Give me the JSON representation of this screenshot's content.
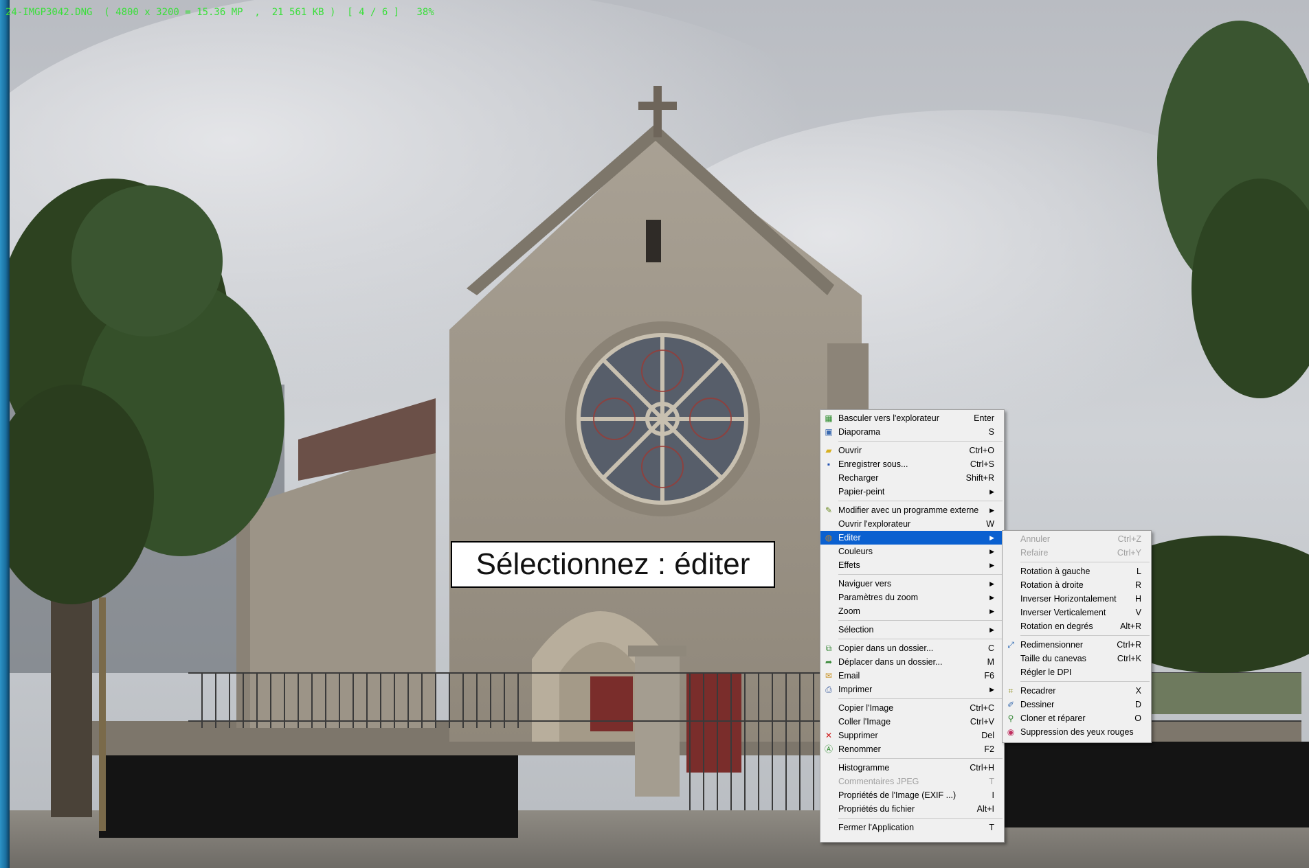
{
  "viewer": {
    "info": "24-IMGP3042.DNG  ( 4800 x 3200 = 15.36 MP  ,  21 561 KB )  [ 4 / 6 ]   38%"
  },
  "caption": "Sélectionnez : éditer",
  "context_menu": [
    {
      "label": "Basculer vers l'explorateur",
      "shortcut": "Enter",
      "icon": "explorer-icon"
    },
    {
      "label": "Diaporama",
      "shortcut": "S",
      "icon": "slideshow-icon"
    },
    {
      "sep": true
    },
    {
      "label": "Ouvrir",
      "shortcut": "Ctrl+O",
      "icon": "open-folder-icon"
    },
    {
      "label": "Enregistrer sous...",
      "shortcut": "Ctrl+S",
      "icon": "save-icon"
    },
    {
      "label": "Recharger",
      "shortcut": "Shift+R"
    },
    {
      "label": "Papier-peint",
      "submenu": true
    },
    {
      "sep": true
    },
    {
      "label": "Modifier avec un programme externe",
      "submenu": true,
      "icon": "external-program-icon"
    },
    {
      "label": "Ouvrir l'explorateur",
      "shortcut": "W"
    },
    {
      "label": "Editer",
      "submenu": true,
      "selected": true,
      "icon": "edit-palette-icon"
    },
    {
      "label": "Couleurs",
      "submenu": true
    },
    {
      "label": "Effets",
      "submenu": true
    },
    {
      "sep": true
    },
    {
      "label": "Naviguer vers",
      "submenu": true
    },
    {
      "label": "Paramètres du zoom",
      "submenu": true
    },
    {
      "label": "Zoom",
      "submenu": true
    },
    {
      "sep": true
    },
    {
      "label": "Sélection",
      "submenu": true
    },
    {
      "sep": true
    },
    {
      "label": "Copier dans un dossier...",
      "shortcut": "C",
      "icon": "copy-to-folder-icon"
    },
    {
      "label": "Déplacer dans un dossier...",
      "shortcut": "M",
      "icon": "move-to-folder-icon"
    },
    {
      "label": "Email",
      "shortcut": "F6",
      "icon": "email-icon"
    },
    {
      "label": "Imprimer",
      "submenu": true,
      "icon": "printer-icon"
    },
    {
      "sep": true
    },
    {
      "label": "Copier l'Image",
      "shortcut": "Ctrl+C"
    },
    {
      "label": "Coller l'Image",
      "shortcut": "Ctrl+V"
    },
    {
      "label": "Supprimer",
      "shortcut": "Del",
      "icon": "delete-x-icon"
    },
    {
      "label": "Renommer",
      "shortcut": "F2",
      "icon": "rename-icon"
    },
    {
      "sep": true
    },
    {
      "label": "Histogramme",
      "shortcut": "Ctrl+H"
    },
    {
      "label": "Commentaires JPEG",
      "shortcut": "T",
      "disabled": true
    },
    {
      "label": "Propriétés de l'Image (EXIF ...)",
      "shortcut": "I"
    },
    {
      "label": "Propriétés du fichier",
      "shortcut": "Alt+I"
    },
    {
      "sep": true
    },
    {
      "label": "Fermer l'Application",
      "shortcut": "T"
    }
  ],
  "edit_submenu": [
    {
      "label": "Annuler",
      "shortcut": "Ctrl+Z",
      "disabled": true
    },
    {
      "label": "Refaire",
      "shortcut": "Ctrl+Y",
      "disabled": true
    },
    {
      "sep": true
    },
    {
      "label": "Rotation à gauche",
      "shortcut": "L"
    },
    {
      "label": "Rotation à droite",
      "shortcut": "R"
    },
    {
      "label": "Inverser Horizontalement",
      "shortcut": "H"
    },
    {
      "label": "Inverser Verticalement",
      "shortcut": "V"
    },
    {
      "label": "Rotation en degrés",
      "shortcut": "Alt+R"
    },
    {
      "sep": true
    },
    {
      "label": "Redimensionner",
      "shortcut": "Ctrl+R",
      "icon": "resize-icon"
    },
    {
      "label": "Taille du canevas",
      "shortcut": "Ctrl+K"
    },
    {
      "label": "Régler le DPI"
    },
    {
      "sep": true
    },
    {
      "label": "Recadrer",
      "shortcut": "X",
      "icon": "crop-icon"
    },
    {
      "label": "Dessiner",
      "shortcut": "D",
      "icon": "draw-icon"
    },
    {
      "label": "Cloner et réparer",
      "shortcut": "O",
      "icon": "clone-stamp-icon"
    },
    {
      "label": "Suppression des yeux rouges",
      "icon": "red-eye-icon"
    }
  ],
  "icon_glyphs": {
    "explorer-icon": "▦",
    "slideshow-icon": "▣",
    "open-folder-icon": "▰",
    "save-icon": "▪",
    "external-program-icon": "✎",
    "edit-palette-icon": "◍",
    "copy-to-folder-icon": "⧉",
    "move-to-folder-icon": "➦",
    "email-icon": "✉",
    "printer-icon": "⎙",
    "delete-x-icon": "✕",
    "rename-icon": "Ⓐ",
    "resize-icon": "⤢",
    "crop-icon": "⌗",
    "draw-icon": "✐",
    "clone-stamp-icon": "⚲",
    "red-eye-icon": "◉"
  },
  "icon_colors": {
    "explorer-icon": "#2a8a2a",
    "slideshow-icon": "#3a6ab0",
    "open-folder-icon": "#d8b020",
    "save-icon": "#2050b0",
    "external-program-icon": "#6a8a20",
    "edit-palette-icon": "#c08020",
    "copy-to-folder-icon": "#3a8a3a",
    "move-to-folder-icon": "#3a8a3a",
    "email-icon": "#c89020",
    "printer-icon": "#4060a0",
    "delete-x-icon": "#d02020",
    "rename-icon": "#2a8a2a",
    "resize-icon": "#2060b0",
    "crop-icon": "#909020",
    "draw-icon": "#4070b0",
    "clone-stamp-icon": "#3a8a3a",
    "red-eye-icon": "#c03060"
  }
}
